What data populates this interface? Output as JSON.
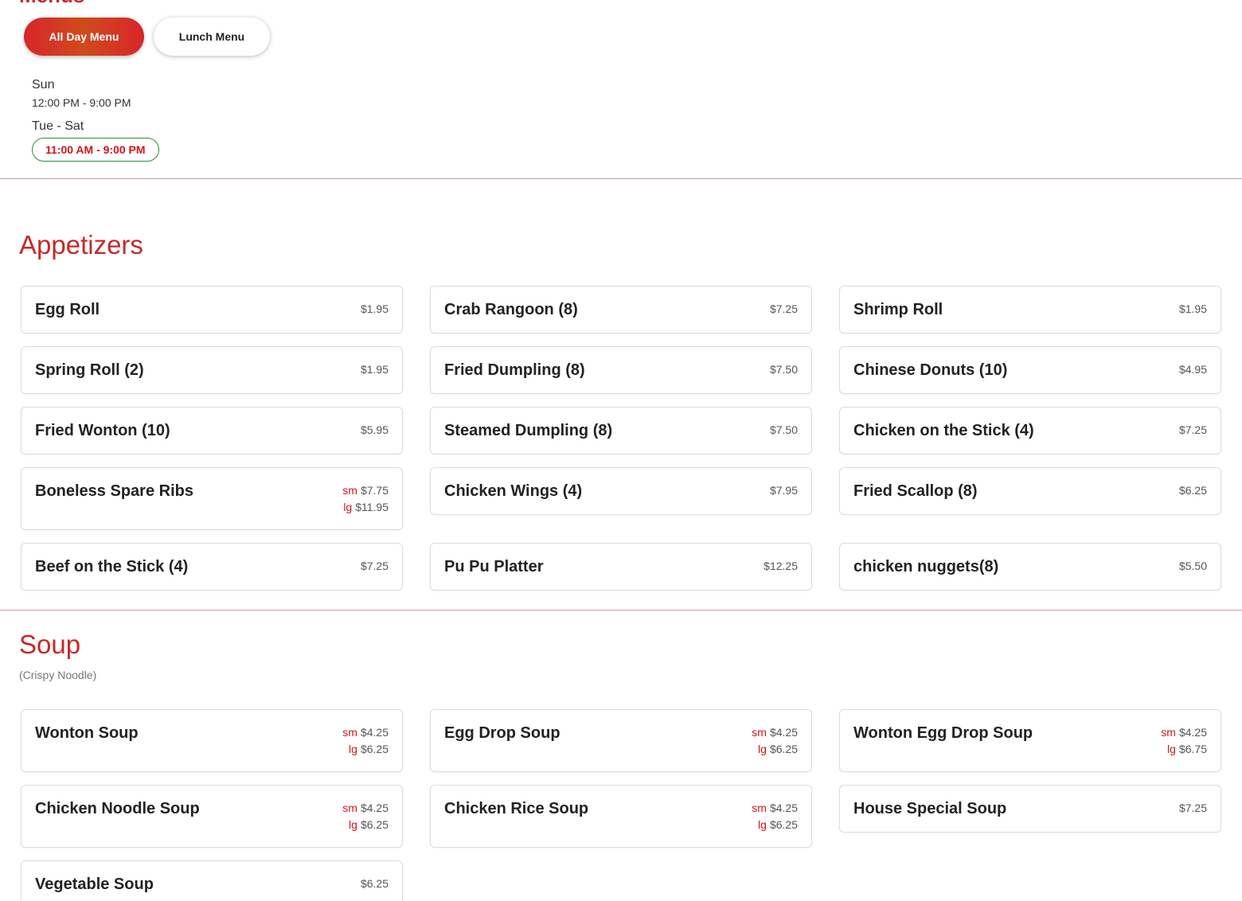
{
  "menus_heading": "Menus",
  "tabs": [
    {
      "label": "All Day Menu",
      "active": true
    },
    {
      "label": "Lunch Menu",
      "active": false
    }
  ],
  "hours": [
    {
      "days": "Sun",
      "time": "12:00 PM - 9:00 PM"
    },
    {
      "days": "Tue - Sat",
      "time": "11:00 AM - 9:00 PM"
    }
  ],
  "sections": [
    {
      "title": "Appetizers",
      "items": [
        {
          "name": "Egg Roll",
          "prices": [
            {
              "label": "",
              "value": "$1.95"
            }
          ]
        },
        {
          "name": "Crab Rangoon (8)",
          "prices": [
            {
              "label": "",
              "value": "$7.25"
            }
          ]
        },
        {
          "name": "Shrimp Roll",
          "prices": [
            {
              "label": "",
              "value": "$1.95"
            }
          ]
        },
        {
          "name": "Spring Roll (2)",
          "prices": [
            {
              "label": "",
              "value": "$1.95"
            }
          ]
        },
        {
          "name": "Fried Dumpling (8)",
          "prices": [
            {
              "label": "",
              "value": "$7.50"
            }
          ]
        },
        {
          "name": "Chinese Donuts (10)",
          "prices": [
            {
              "label": "",
              "value": "$4.95"
            }
          ]
        },
        {
          "name": "Fried Wonton (10)",
          "prices": [
            {
              "label": "",
              "value": "$5.95"
            }
          ]
        },
        {
          "name": "Steamed Dumpling (8)",
          "prices": [
            {
              "label": "",
              "value": "$7.50"
            }
          ]
        },
        {
          "name": "Chicken on the Stick (4)",
          "prices": [
            {
              "label": "",
              "value": "$7.25"
            }
          ]
        },
        {
          "name": "Boneless Spare Ribs",
          "prices": [
            {
              "label": "sm",
              "value": "$7.75"
            },
            {
              "label": "lg",
              "value": "$11.95"
            }
          ]
        },
        {
          "name": "Chicken Wings (4)",
          "prices": [
            {
              "label": "",
              "value": "$7.95"
            }
          ]
        },
        {
          "name": "Fried Scallop (8)",
          "prices": [
            {
              "label": "",
              "value": "$6.25"
            }
          ]
        },
        {
          "name": "Beef on the Stick (4)",
          "prices": [
            {
              "label": "",
              "value": "$7.25"
            }
          ]
        },
        {
          "name": "Pu Pu Platter",
          "prices": [
            {
              "label": "",
              "value": "$12.25"
            }
          ]
        },
        {
          "name": "chicken nuggets(8)",
          "prices": [
            {
              "label": "",
              "value": "$5.50"
            }
          ]
        }
      ]
    },
    {
      "title": "Soup",
      "note": "(Crispy Noodle)",
      "items": [
        {
          "name": "Wonton Soup",
          "prices": [
            {
              "label": "sm",
              "value": "$4.25"
            },
            {
              "label": "lg",
              "value": "$6.25"
            }
          ]
        },
        {
          "name": "Egg Drop Soup",
          "prices": [
            {
              "label": "sm",
              "value": "$4.25"
            },
            {
              "label": "lg",
              "value": "$6.25"
            }
          ]
        },
        {
          "name": "Wonton Egg Drop Soup",
          "prices": [
            {
              "label": "sm",
              "value": "$4.25"
            },
            {
              "label": "lg",
              "value": "$6.75"
            }
          ]
        },
        {
          "name": "Chicken Noodle Soup",
          "prices": [
            {
              "label": "sm",
              "value": "$4.25"
            },
            {
              "label": "lg",
              "value": "$6.25"
            }
          ]
        },
        {
          "name": "Chicken Rice Soup",
          "prices": [
            {
              "label": "sm",
              "value": "$4.25"
            },
            {
              "label": "lg",
              "value": "$6.25"
            }
          ]
        },
        {
          "name": "House Special Soup",
          "prices": [
            {
              "label": "",
              "value": "$7.25"
            }
          ]
        },
        {
          "name": "Vegetable Soup",
          "prices": [
            {
              "label": "",
              "value": "$6.25"
            }
          ]
        }
      ]
    }
  ],
  "colors": {
    "accent": "#c7282a",
    "price_label": "#d0161b",
    "hours_pill_border": "#2e8b3a"
  }
}
